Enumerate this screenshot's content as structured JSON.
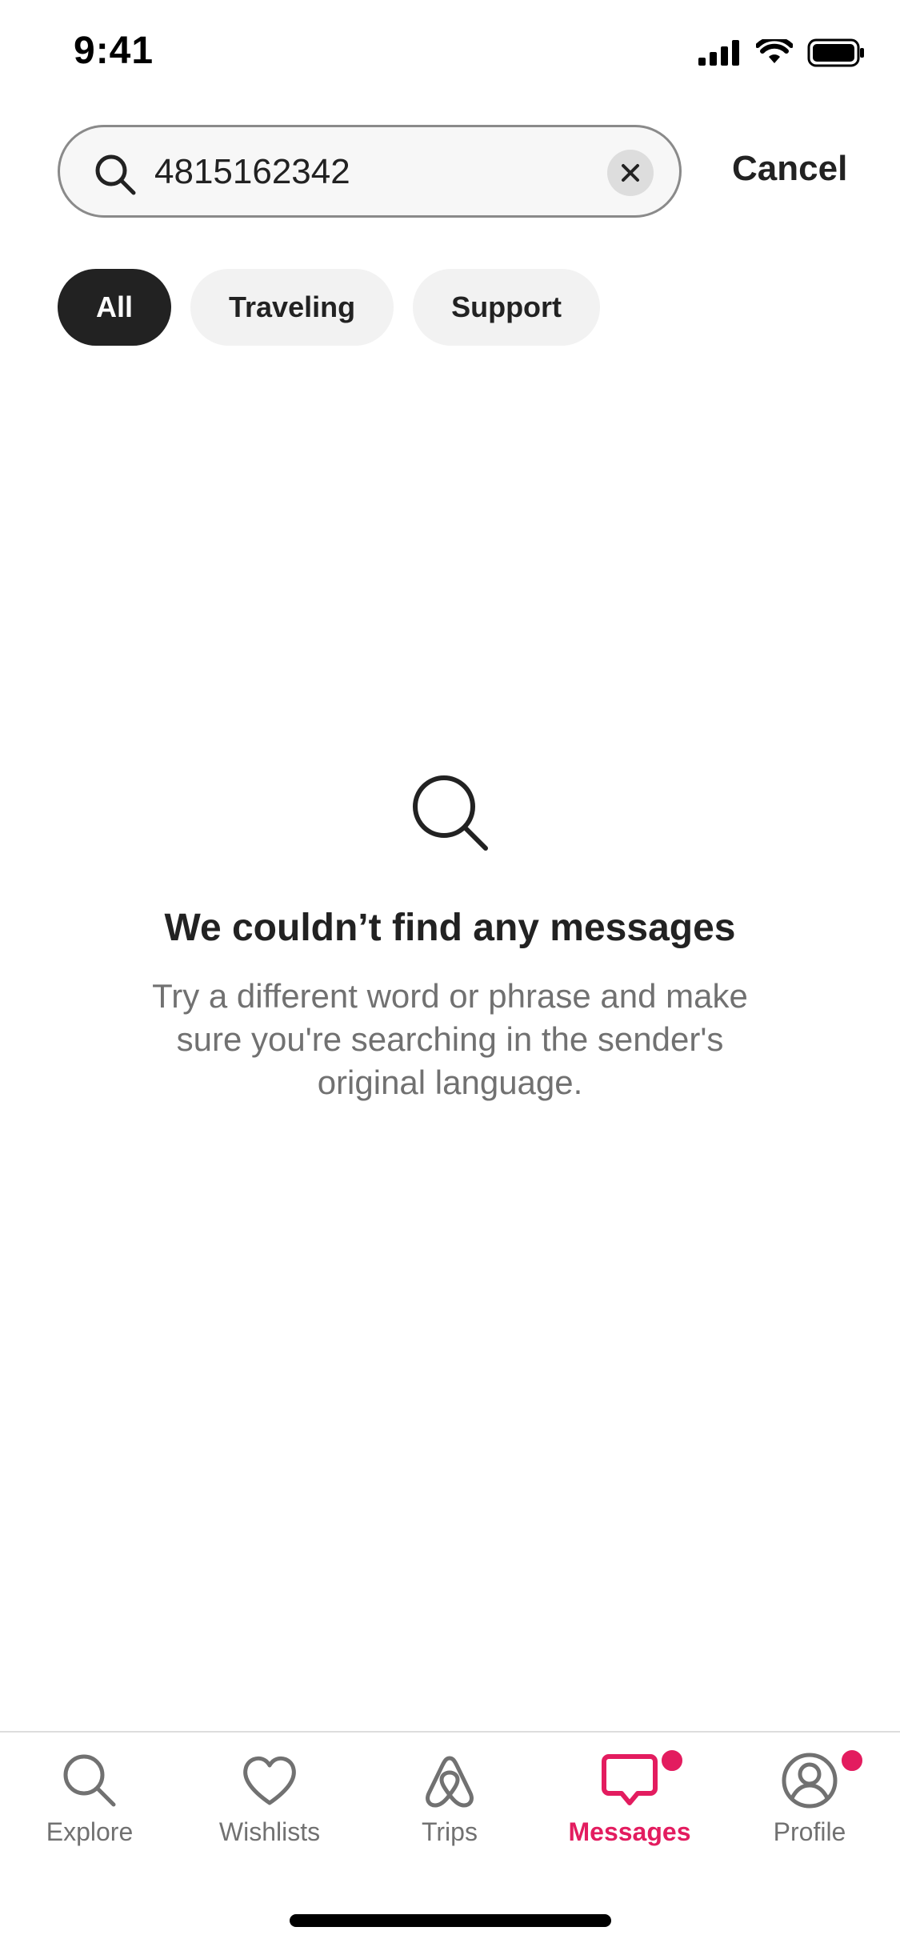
{
  "status_bar": {
    "time": "9:41"
  },
  "search": {
    "value": "4815162342",
    "cancel_label": "Cancel"
  },
  "filters": [
    {
      "label": "All",
      "active": true
    },
    {
      "label": "Traveling",
      "active": false
    },
    {
      "label": "Support",
      "active": false
    }
  ],
  "empty_state": {
    "icon": "search-icon",
    "title": "We couldn’t find any messages",
    "body": "Try a different word or phrase and make sure you're searching in the sender's original language."
  },
  "bottom_nav": {
    "items": [
      {
        "label": "Explore",
        "icon": "search-icon"
      },
      {
        "label": "Wishlists",
        "icon": "heart-icon"
      },
      {
        "label": "Trips",
        "icon": "airbnb-logo-icon"
      },
      {
        "label": "Messages",
        "icon": "message-icon",
        "active": true,
        "badge": true
      },
      {
        "label": "Profile",
        "icon": "profile-icon",
        "badge": true
      }
    ]
  },
  "colors": {
    "accent": "#e31c5f",
    "text": "#222222",
    "muted": "#717171"
  }
}
